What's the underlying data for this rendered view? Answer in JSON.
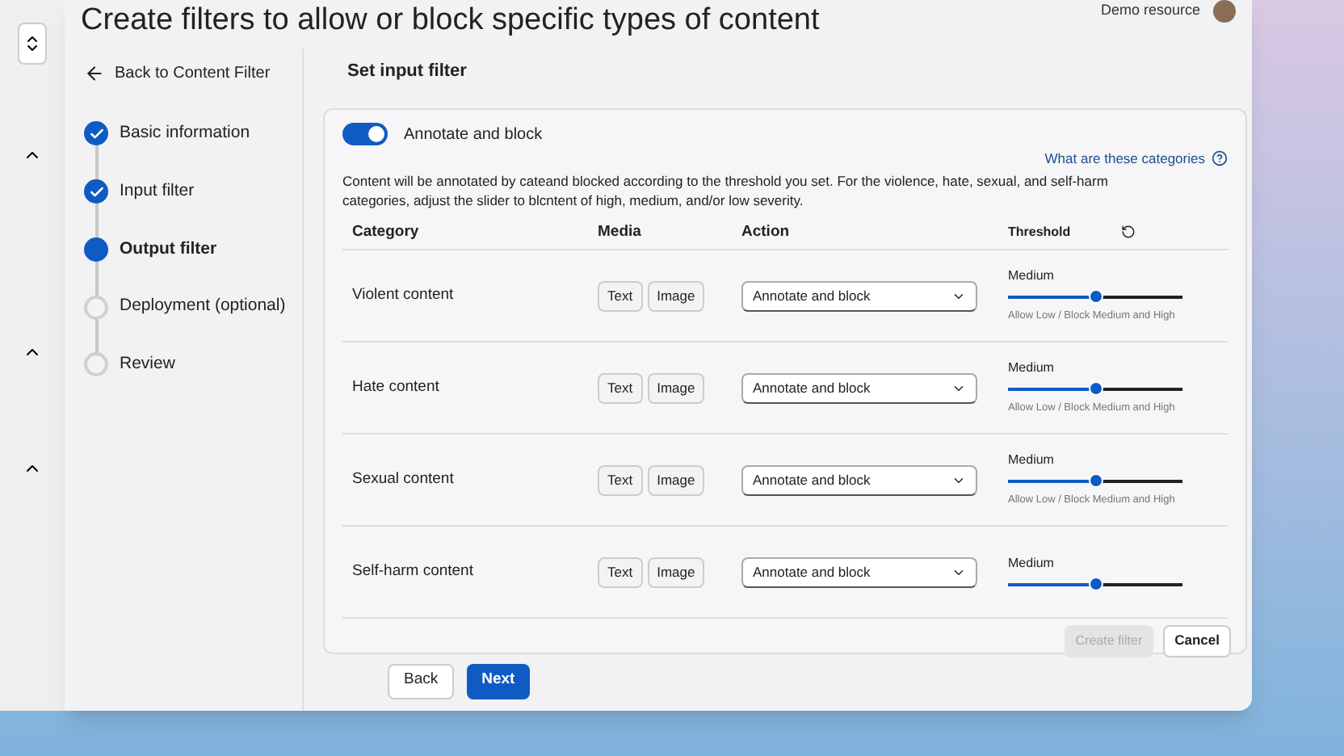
{
  "page_title": "Create filters to allow or block specific types of content",
  "account": {
    "resource": "Demo resource"
  },
  "sidebar": {
    "back_link": "Back to Content Filter",
    "steps": [
      {
        "label": "Basic information",
        "kind": "done",
        "selected": false
      },
      {
        "label": "Input filter",
        "kind": "done",
        "selected": false
      },
      {
        "label": "Output filter",
        "kind": "current",
        "selected": true
      },
      {
        "label": "Deployment (optional)",
        "kind": "pending",
        "selected": false
      },
      {
        "label": "Review",
        "kind": "pending",
        "selected": false
      }
    ]
  },
  "section_title": "Set input filter",
  "toggle": {
    "label": "Annotate and block",
    "on": true
  },
  "help_link": "What are these categories",
  "description": "Content will be annotated by cateand blocked according to the threshold you set. For the violence, hate, sexual, and self-harm categories, adjust the slider to blcntent of high, medium, and/or low severity.",
  "columns": [
    "Category",
    "Media",
    "Action",
    "Threshold"
  ],
  "rows": [
    {
      "category": "Violent content",
      "media": [
        "Text",
        "Image"
      ],
      "action": "Annotate and block",
      "threshold": "Medium",
      "level": 0.5,
      "caption": "Allow Low / Block Medium and High"
    },
    {
      "category": "Hate content",
      "media": [
        "Text",
        "Image"
      ],
      "action": "Annotate and block",
      "threshold": "Medium",
      "level": 0.5,
      "caption": "Allow Low / Block Medium and High"
    },
    {
      "category": "Sexual content",
      "media": [
        "Text",
        "Image"
      ],
      "action": "Annotate and block",
      "threshold": "Medium",
      "level": 0.5,
      "caption": "Allow Low / Block Medium and High"
    },
    {
      "category": "Self-harm content",
      "media": [
        "Text",
        "Image"
      ],
      "action": "Annotate and block",
      "threshold": "Medium",
      "level": 0.5
    }
  ],
  "footer": {
    "create": {
      "label": "Create filter",
      "disabled": true
    },
    "cancel": "Cancel"
  },
  "nav_buttons": [
    {
      "label": "Back",
      "kind": "secondary"
    },
    {
      "label": "Next",
      "kind": "primary"
    }
  ]
}
